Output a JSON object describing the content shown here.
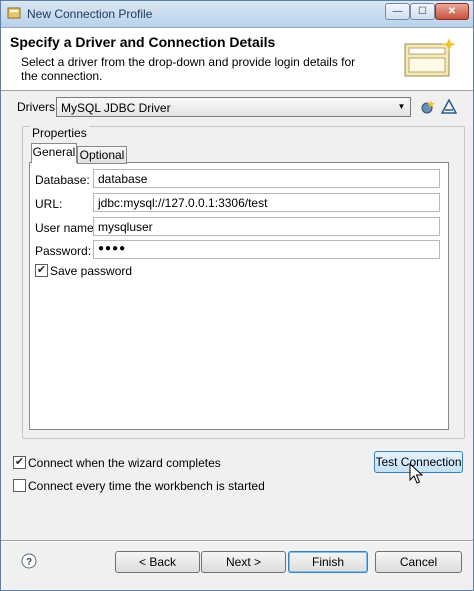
{
  "window": {
    "title": "New Connection Profile",
    "controls": {
      "minimize": "—",
      "maximize": "☐",
      "close": "✕"
    }
  },
  "header": {
    "title": "Specify a Driver and Connection Details",
    "description": "Select a driver from the drop-down and provide login details for the connection."
  },
  "drivers": {
    "label": "Drivers:",
    "selected": "MySQL JDBC Driver",
    "icons": [
      "new-driver-icon",
      "edit-driver-icon"
    ]
  },
  "properties": {
    "label": "Properties",
    "tabs": [
      {
        "label": "General",
        "active": true
      },
      {
        "label": "Optional",
        "active": false
      }
    ],
    "fields": [
      {
        "label": "Database:",
        "value": "database"
      },
      {
        "label": "URL:",
        "value": "jdbc:mysql://127.0.0.1:3306/test"
      },
      {
        "label": "User name:",
        "value": "mysqluser"
      },
      {
        "label": "Password:",
        "value": "●●●●"
      }
    ],
    "save_password": {
      "label": "Save password",
      "checked": true
    }
  },
  "options": {
    "connect_when_complete": {
      "label": "Connect when the wizard completes",
      "checked": true
    },
    "connect_every_time": {
      "label": "Connect every time the workbench is started",
      "checked": false
    },
    "test_connection": "Test Connection"
  },
  "footer": {
    "back": "< Back",
    "next": "Next >",
    "finish": "Finish",
    "cancel": "Cancel",
    "help_icon": "help-icon"
  },
  "colors": {
    "accent": "#3c7fb1",
    "title_bar": "#b9d1ea",
    "close": "#c7513b"
  }
}
